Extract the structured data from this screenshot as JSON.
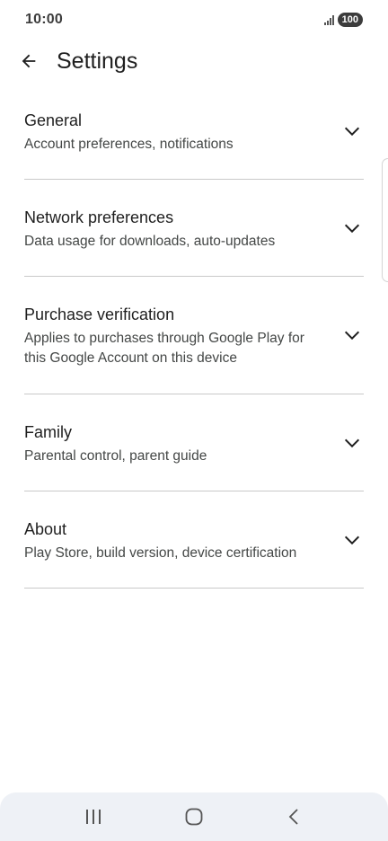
{
  "status_bar": {
    "time": "10:00",
    "battery": "100",
    "signal_icon": "signal-icon"
  },
  "header": {
    "back_icon": "arrow-back-icon",
    "title": "Settings"
  },
  "items": [
    {
      "title": "General",
      "subtitle": "Account preferences, notifications",
      "icon": "chevron-down-icon"
    },
    {
      "title": "Network preferences",
      "subtitle": "Data usage for downloads, auto-updates",
      "icon": "chevron-down-icon"
    },
    {
      "title": "Purchase verification",
      "subtitle": "Applies to purchases through Google Play for this Google Account on this device",
      "icon": "chevron-down-icon"
    },
    {
      "title": "Family",
      "subtitle": "Parental control, parent guide",
      "icon": "chevron-down-icon"
    },
    {
      "title": "About",
      "subtitle": "Play Store, build version, device certification",
      "icon": "chevron-down-icon"
    }
  ],
  "nav_bar": {
    "recents_icon": "recents-icon",
    "home_icon": "home-icon",
    "back_icon": "nav-back-icon"
  },
  "colors": {
    "text_primary": "#1f1f1f",
    "text_secondary": "#444746",
    "divider": "#c9c9c9",
    "nav_bg": "#eef1f6"
  }
}
